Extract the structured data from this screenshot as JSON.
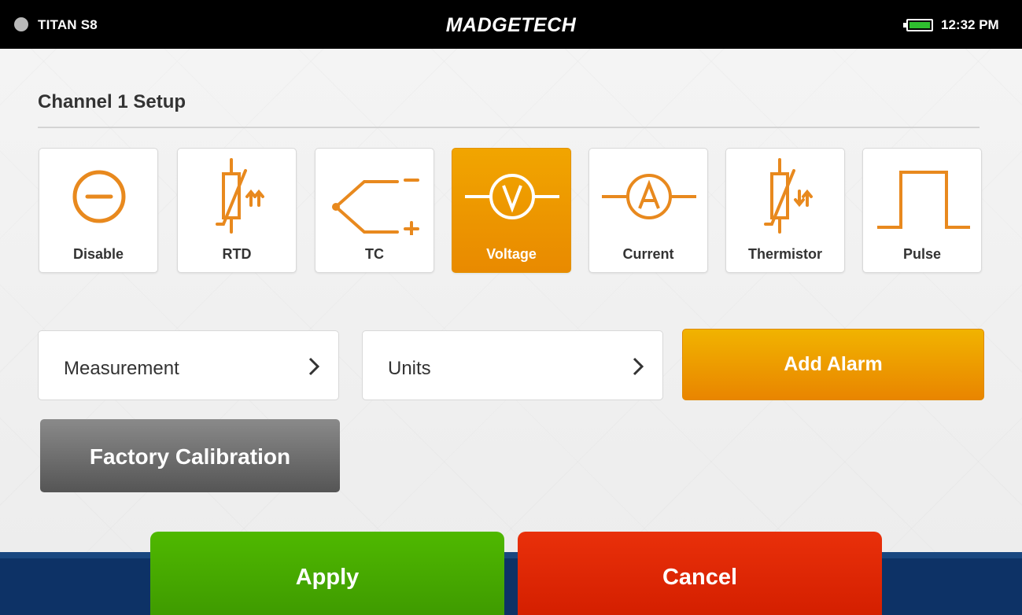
{
  "status_bar": {
    "device_name": "TITAN S8",
    "brand": "MADGETECH",
    "time": "12:32 PM",
    "battery_icon": "battery-full-icon",
    "battery_color": "#2fbf2f"
  },
  "page": {
    "title": "Channel 1 Setup"
  },
  "sensor_types": [
    {
      "label": "Disable",
      "icon": "disable-icon",
      "selected": false
    },
    {
      "label": "RTD",
      "icon": "rtd-icon",
      "selected": false
    },
    {
      "label": "TC",
      "icon": "thermocouple-icon",
      "selected": false
    },
    {
      "label": "Voltage",
      "icon": "voltmeter-icon",
      "selected": true
    },
    {
      "label": "Current",
      "icon": "ammeter-icon",
      "selected": false
    },
    {
      "label": "Thermistor",
      "icon": "thermistor-icon",
      "selected": false
    },
    {
      "label": "Pulse",
      "icon": "pulse-icon",
      "selected": false
    }
  ],
  "settings": {
    "measurement_label": "Measurement",
    "units_label": "Units",
    "add_alarm_label": "Add Alarm",
    "factory_calibration_label": "Factory Calibration"
  },
  "footer": {
    "apply_label": "Apply",
    "cancel_label": "Cancel"
  },
  "colors": {
    "accent_orange": "#e98a00",
    "apply_green": "#45a800",
    "cancel_red": "#d92600",
    "footer_navy": "#0d3266",
    "icon_orange": "#e8891e"
  }
}
